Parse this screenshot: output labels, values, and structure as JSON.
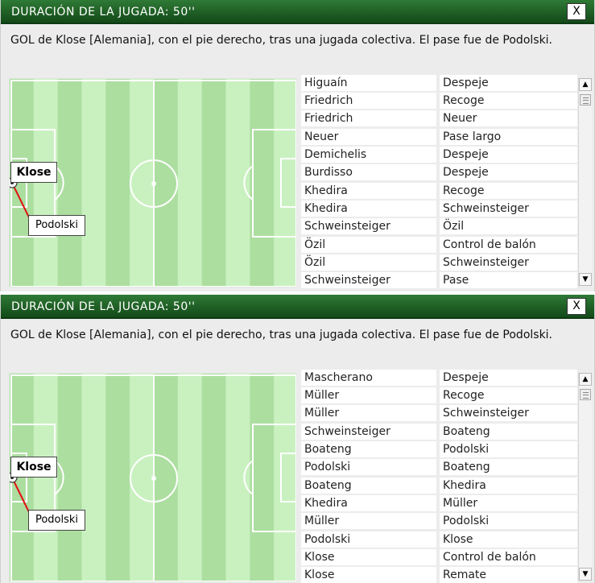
{
  "panels": [
    {
      "title": "DURACIÓN DE LA JUGADA: 50''",
      "close_label": "X",
      "description": "GOL de Klose [Alemania], con el pie derecho, tras una jugada colectiva. El pase fue de Podolski.",
      "scorer_tag": "Klose",
      "assist_tag": "Podolski",
      "plays": [
        [
          "Higuaín",
          "Despeje"
        ],
        [
          "Friedrich",
          "Recoge"
        ],
        [
          "Friedrich",
          "Neuer"
        ],
        [
          "Neuer",
          "Pase largo"
        ],
        [
          "Demichelis",
          "Despeje"
        ],
        [
          "Burdisso",
          "Despeje"
        ],
        [
          "Khedira",
          "Recoge"
        ],
        [
          "Khedira",
          "Schweinsteiger"
        ],
        [
          "Schweinsteiger",
          "Özil"
        ],
        [
          "Özil",
          "Control de balón"
        ],
        [
          "Özil",
          "Schweinsteiger"
        ],
        [
          "Schweinsteiger",
          "Pase"
        ]
      ]
    },
    {
      "title": "DURACIÓN DE LA JUGADA: 50''",
      "close_label": "X",
      "description": "GOL de Klose [Alemania], con el pie derecho, tras una jugada colectiva. El pase fue de Podolski.",
      "scorer_tag": "Klose",
      "assist_tag": "Podolski",
      "plays": [
        [
          "Mascherano",
          "Despeje"
        ],
        [
          "Müller",
          "Recoge"
        ],
        [
          "Müller",
          "Schweinsteiger"
        ],
        [
          "Schweinsteiger",
          "Boateng"
        ],
        [
          "Boateng",
          "Podolski"
        ],
        [
          "Podolski",
          "Boateng"
        ],
        [
          "Boateng",
          "Khedira"
        ],
        [
          "Khedira",
          "Müller"
        ],
        [
          "Müller",
          "Podolski"
        ],
        [
          "Podolski",
          "Klose"
        ],
        [
          "Klose",
          "Control de balón"
        ],
        [
          "Klose",
          "Remate"
        ]
      ]
    }
  ],
  "scrollbar": {
    "up_icon": "▲",
    "down_icon": "▼"
  },
  "colors": {
    "title_bar": "#1f5f25",
    "pitch_light": "#c9f1c0",
    "pitch_dark": "#acdea0",
    "pass_line": "#e01010"
  }
}
